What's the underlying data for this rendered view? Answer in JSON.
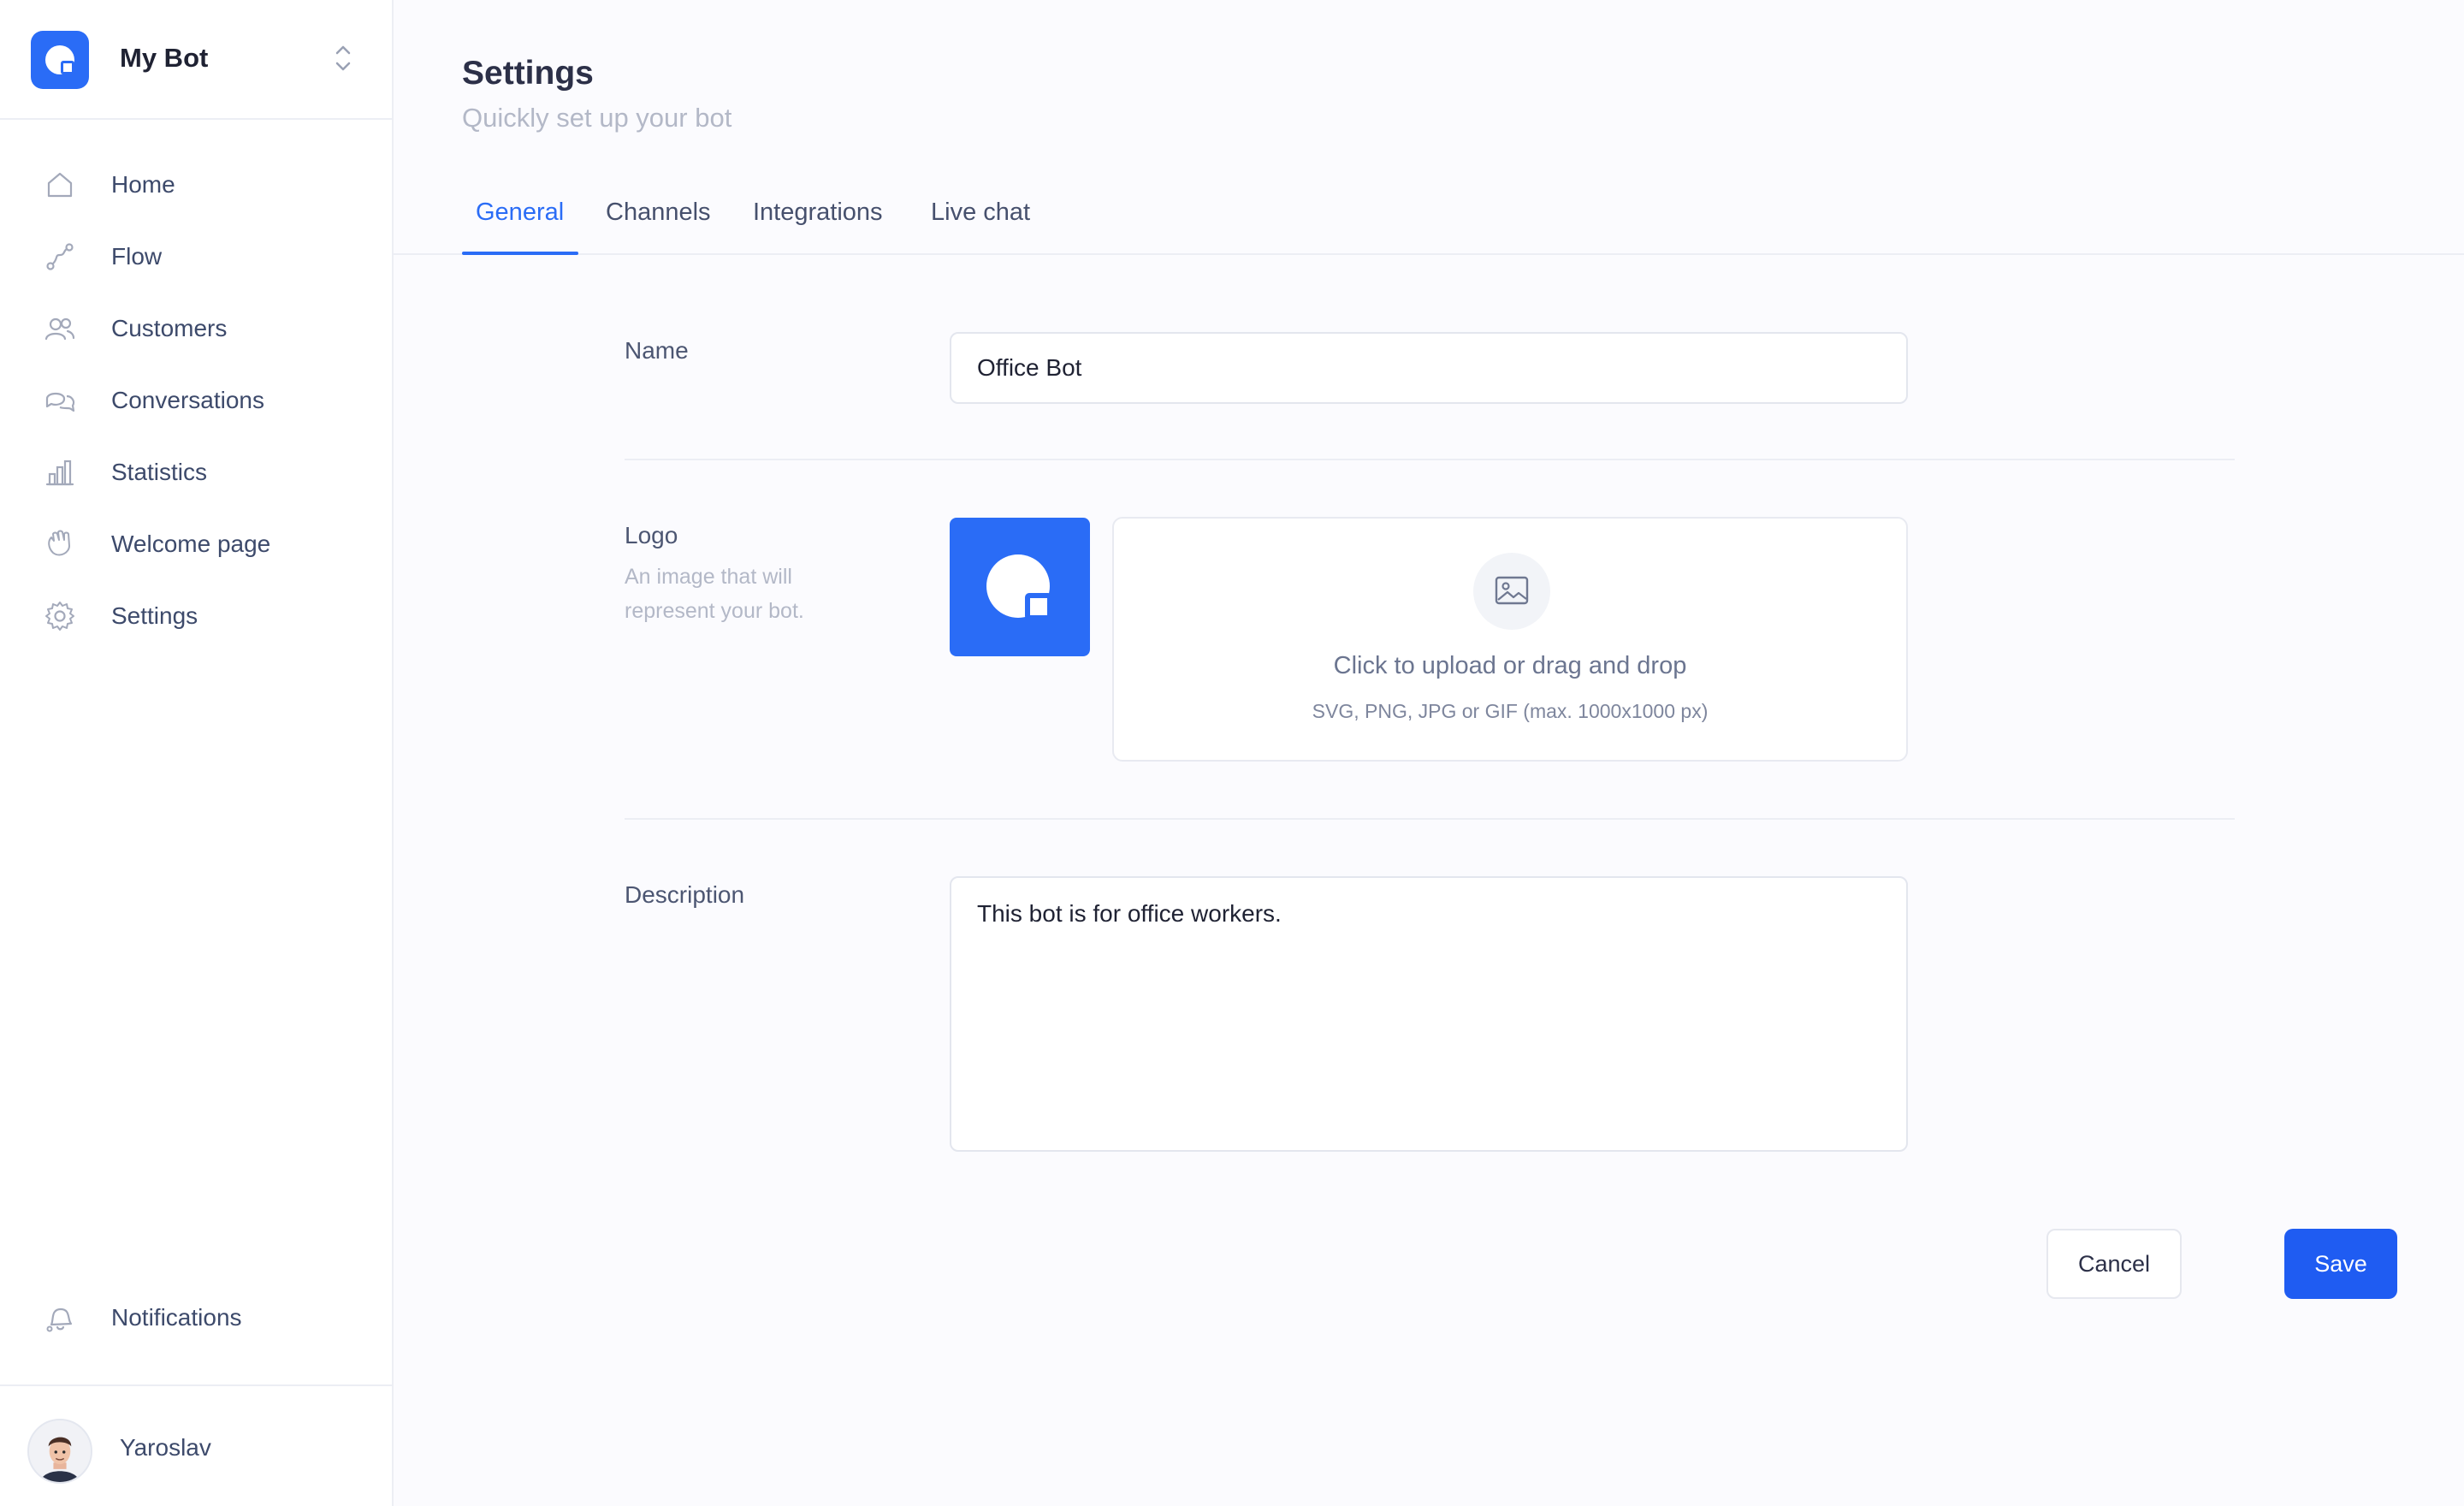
{
  "app": {
    "name": "My Bot",
    "accent_color": "#2a6cf6"
  },
  "sidebar": {
    "items": [
      {
        "label": "Home",
        "icon": "home-icon"
      },
      {
        "label": "Flow",
        "icon": "flow-icon"
      },
      {
        "label": "Customers",
        "icon": "users-icon"
      },
      {
        "label": "Conversations",
        "icon": "chat-icon"
      },
      {
        "label": "Statistics",
        "icon": "bar-chart-icon"
      },
      {
        "label": "Welcome page",
        "icon": "wave-hand-icon"
      },
      {
        "label": "Settings",
        "icon": "gear-icon"
      }
    ],
    "notifications": {
      "label": "Notifications",
      "icon": "bell-icon"
    },
    "user": {
      "name": "Yaroslav"
    }
  },
  "page": {
    "title": "Settings",
    "subtitle": "Quickly set up your bot"
  },
  "tabs": [
    {
      "label": "General",
      "active": true
    },
    {
      "label": "Channels",
      "active": false
    },
    {
      "label": "Integrations",
      "active": false
    },
    {
      "label": "Live chat",
      "active": false
    }
  ],
  "form": {
    "name": {
      "label": "Name",
      "value": "Office Bot"
    },
    "logo": {
      "label": "Logo",
      "hint": "An image that will represent your bot.",
      "upload_title": "Click to upload or drag and drop",
      "upload_hint": "SVG, PNG, JPG or GIF (max. 1000x1000 px)"
    },
    "description": {
      "label": "Description",
      "value": "This bot is for office workers."
    }
  },
  "actions": {
    "cancel_label": "Cancel",
    "save_label": "Save"
  }
}
